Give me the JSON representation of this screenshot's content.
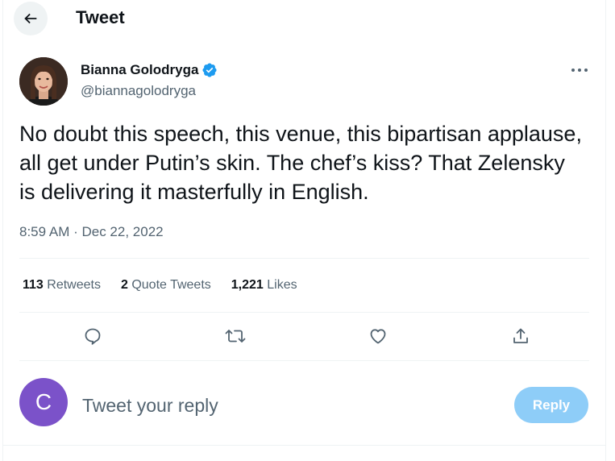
{
  "header": {
    "title": "Tweet",
    "back_icon": "arrow-left-icon"
  },
  "author": {
    "name": "Bianna Golodryga",
    "handle": "@biannagolodryga",
    "verified_icon": "verified-badge-icon",
    "verified_color": "#1d9bf0"
  },
  "tweet": {
    "text": "No doubt this speech, this venue, this bipartisan applause, all get under Putin’s skin. The chef’s kiss? That Zelensky is delivering it masterfully in English.",
    "timestamp": "8:59 AM · Dec 22, 2022"
  },
  "stats": {
    "retweets_count": "113",
    "retweets_label": "Retweets",
    "quotes_count": "2",
    "quotes_label": "Quote Tweets",
    "likes_count": "1,221",
    "likes_label": "Likes"
  },
  "actions": [
    "reply-icon",
    "retweet-icon",
    "like-icon",
    "share-icon"
  ],
  "reply": {
    "avatar_letter": "C",
    "avatar_color": "#7b52c9",
    "placeholder": "Tweet your reply",
    "button_label": "Reply",
    "button_color": "#8ecdf8"
  }
}
